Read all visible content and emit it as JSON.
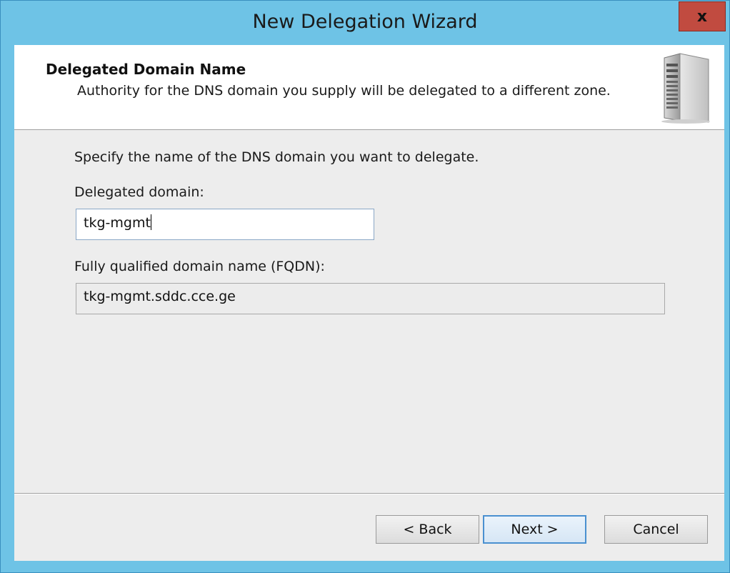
{
  "window": {
    "title": "New Delegation Wizard",
    "close_label": "x"
  },
  "header": {
    "title": "Delegated Domain Name",
    "subtitle": "Authority for the DNS domain you supply will be delegated to a different zone.",
    "icon": "server-icon"
  },
  "form": {
    "instruction": "Specify the name of the DNS domain you want to delegate.",
    "delegated_domain_label": "Delegated domain:",
    "delegated_domain_value": "tkg-mgmt",
    "fqdn_label": "Fully qualified domain name (FQDN):",
    "fqdn_value": "tkg-mgmt.sddc.cce.ge"
  },
  "buttons": {
    "back": "< Back",
    "next": "Next >",
    "cancel": "Cancel"
  },
  "colors": {
    "titlebar": "#6ec3e6",
    "close_button": "#c14b40",
    "dialog_bg": "#ededed"
  }
}
